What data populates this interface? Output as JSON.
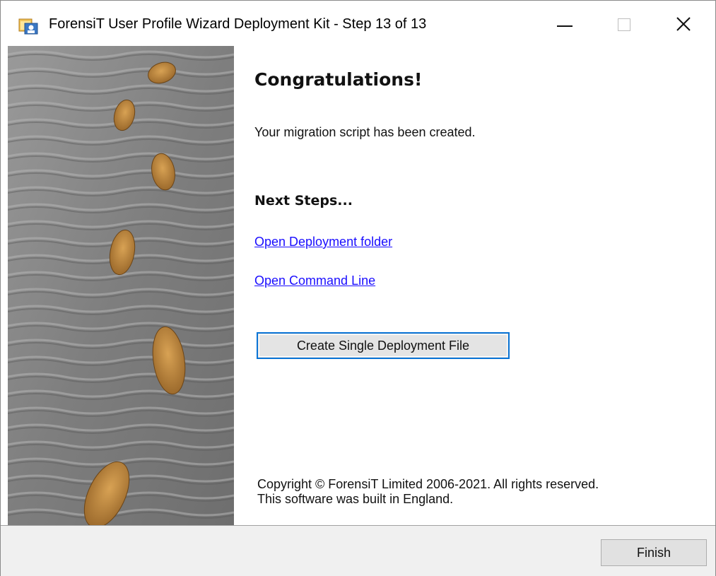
{
  "window": {
    "title": "ForensiT User Profile Wizard Deployment Kit - Step 13 of 13"
  },
  "content": {
    "heading": "Congratulations!",
    "message": "Your migration script has been created.",
    "next_steps_heading": "Next Steps...",
    "links": [
      {
        "label": "Open Deployment folder"
      },
      {
        "label": "Open Command Line"
      }
    ],
    "create_button_label": "Create Single Deployment File",
    "copyright_line1": "Copyright © ForensiT Limited 2006-2021. All rights reserved.",
    "copyright_line2": "This software was built in England."
  },
  "footer": {
    "finish_label": "Finish"
  },
  "colors": {
    "link": "#1a0dff",
    "focus_border": "#0a74d6",
    "sand": "#8a8a8a",
    "footprint": "#b8843e"
  },
  "icons": [
    "app-icon",
    "minimize-icon",
    "maximize-icon",
    "close-icon",
    "footprints-image"
  ]
}
